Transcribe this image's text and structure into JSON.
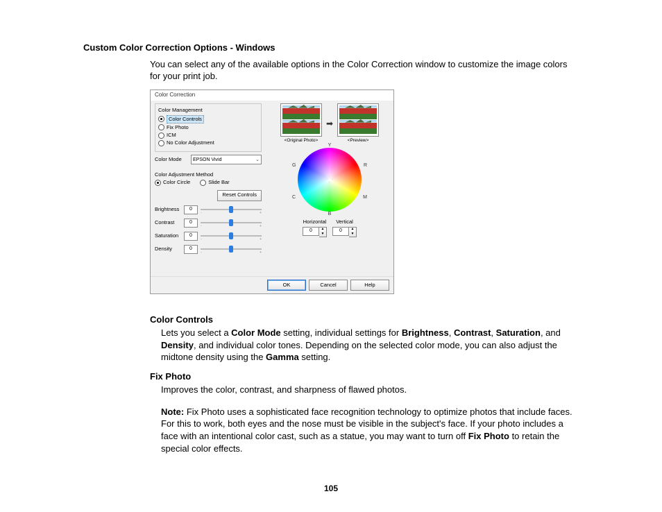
{
  "doc": {
    "heading": "Custom Color Correction Options - Windows",
    "intro": "You can select any of the available options in the Color Correction window to customize the image colors for your print job.",
    "cc": {
      "title": "Color Controls",
      "p1a": "Lets you select a ",
      "b1": "Color Mode",
      "p1b": " setting, individual settings for ",
      "b2": "Brightness",
      "sep": ", ",
      "b3": "Contrast",
      "b4": "Saturation",
      "p1c": ", and ",
      "b5": "Density",
      "p1d": ", and individual color tones. Depending on the selected color mode, you can also adjust the midtone density using the ",
      "b6": "Gamma",
      "p1e": " setting."
    },
    "fp": {
      "title": "Fix Photo",
      "desc": "Improves the color, contrast, and sharpness of flawed photos.",
      "noteLabel": "Note: ",
      "note1": "Fix Photo uses a sophisticated face recognition technology to optimize photos that include faces. For this to work, both eyes and the nose must be visible in the subject's face. If your photo includes a face with an intentional color cast, such as a statue, you may want to turn off ",
      "noteBold": "Fix Photo",
      "note2": " to retain the special color effects."
    },
    "page": "105"
  },
  "dlg": {
    "title": "Color Correction",
    "mgmt": {
      "label": "Color Management",
      "options": [
        "Color Controls",
        "Fix Photo",
        "ICM",
        "No Color Adjustment"
      ]
    },
    "colorMode": {
      "label": "Color Mode",
      "value": "EPSON Vivid"
    },
    "method": {
      "label": "Color Adjustment Method",
      "options": [
        "Color Circle",
        "Slide Bar"
      ]
    },
    "resetLabel": "Reset Controls",
    "sliders": [
      {
        "label": "Brightness",
        "value": "0"
      },
      {
        "label": "Contrast",
        "value": "0"
      },
      {
        "label": "Saturation",
        "value": "0"
      },
      {
        "label": "Density",
        "value": "0"
      }
    ],
    "preview": {
      "left": "<Original Photo>",
      "right": "<Preview>"
    },
    "wheel": {
      "Y": "Y",
      "G": "G",
      "R": "R",
      "C": "C",
      "M": "M",
      "B": "B"
    },
    "hv": {
      "hLabel": "Horizontal",
      "hValue": "0",
      "vLabel": "Vertical",
      "vValue": "0"
    },
    "buttons": {
      "ok": "OK",
      "cancel": "Cancel",
      "help": "Help"
    }
  }
}
